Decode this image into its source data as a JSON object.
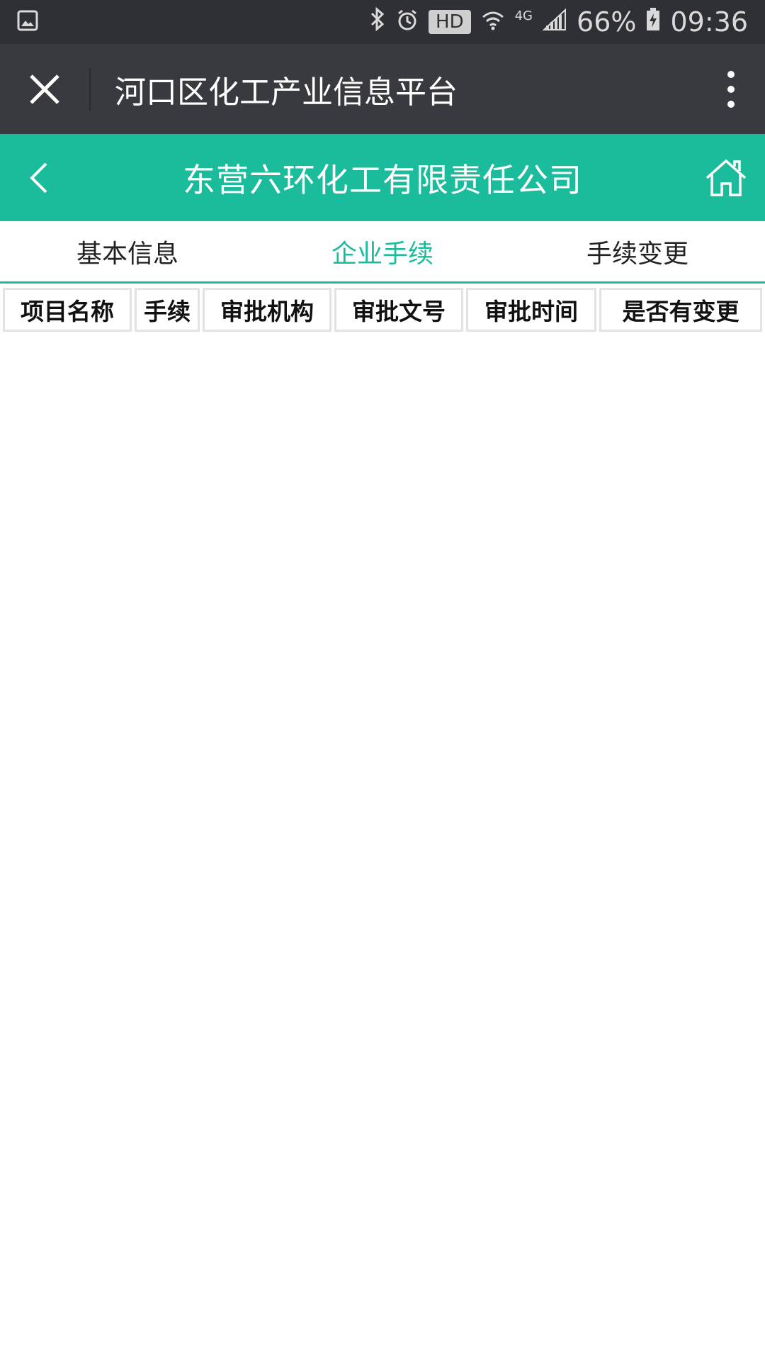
{
  "status_bar": {
    "hd": "HD",
    "network": "4G",
    "battery": "66%",
    "time": "09:36"
  },
  "title_bar": {
    "title": "河口区化工产业信息平台"
  },
  "header": {
    "company": "东营六环化工有限责任公司"
  },
  "tabs": [
    {
      "label": "基本信息",
      "active": false
    },
    {
      "label": "企业手续",
      "active": true
    },
    {
      "label": "手续变更",
      "active": false
    }
  ],
  "table": {
    "columns": [
      "项目名称",
      "手续",
      "审批机构",
      "审批文号",
      "审批时间",
      "是否有变更"
    ]
  },
  "colors": {
    "accent": "#1bbc9b",
    "title_bar": "#393a3f",
    "status_bar": "#2f3035"
  }
}
